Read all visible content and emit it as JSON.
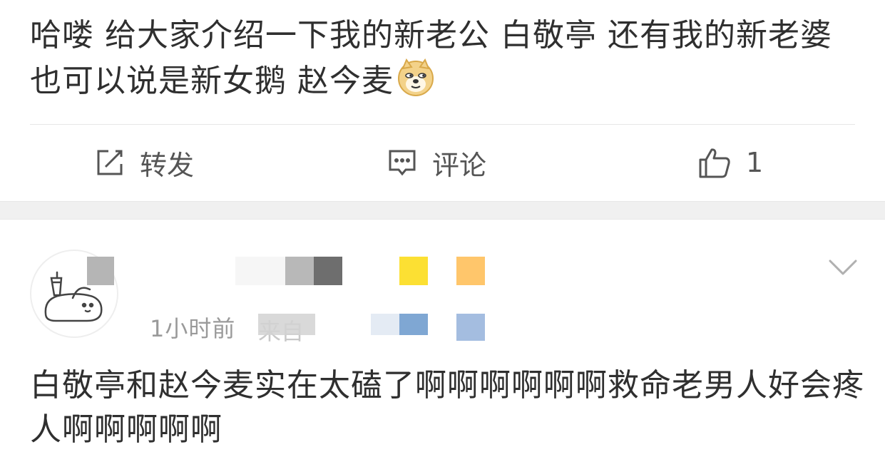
{
  "post": {
    "text": "哈喽 给大家介绍一下我的新老公 白敬亭 还有我的新老婆 也可以说是新女鹅 赵今麦",
    "emoji_icon": "doge-icon"
  },
  "actions": {
    "repost_label": "转发",
    "comment_label": "评论",
    "like_count": "1"
  },
  "comment": {
    "timestamp": "1小时前",
    "source_partial": "来自",
    "text": "白敬亭和赵今麦实在太磕了啊啊啊啊啊啊救命老男人好会疼人啊啊啊啊啊"
  },
  "colors": {
    "badge_yellow": "#fce033",
    "badge_orange": "#ffc66b",
    "badge_blue": "#7fa7d3",
    "badge_light_blue": "#a4bde0"
  }
}
